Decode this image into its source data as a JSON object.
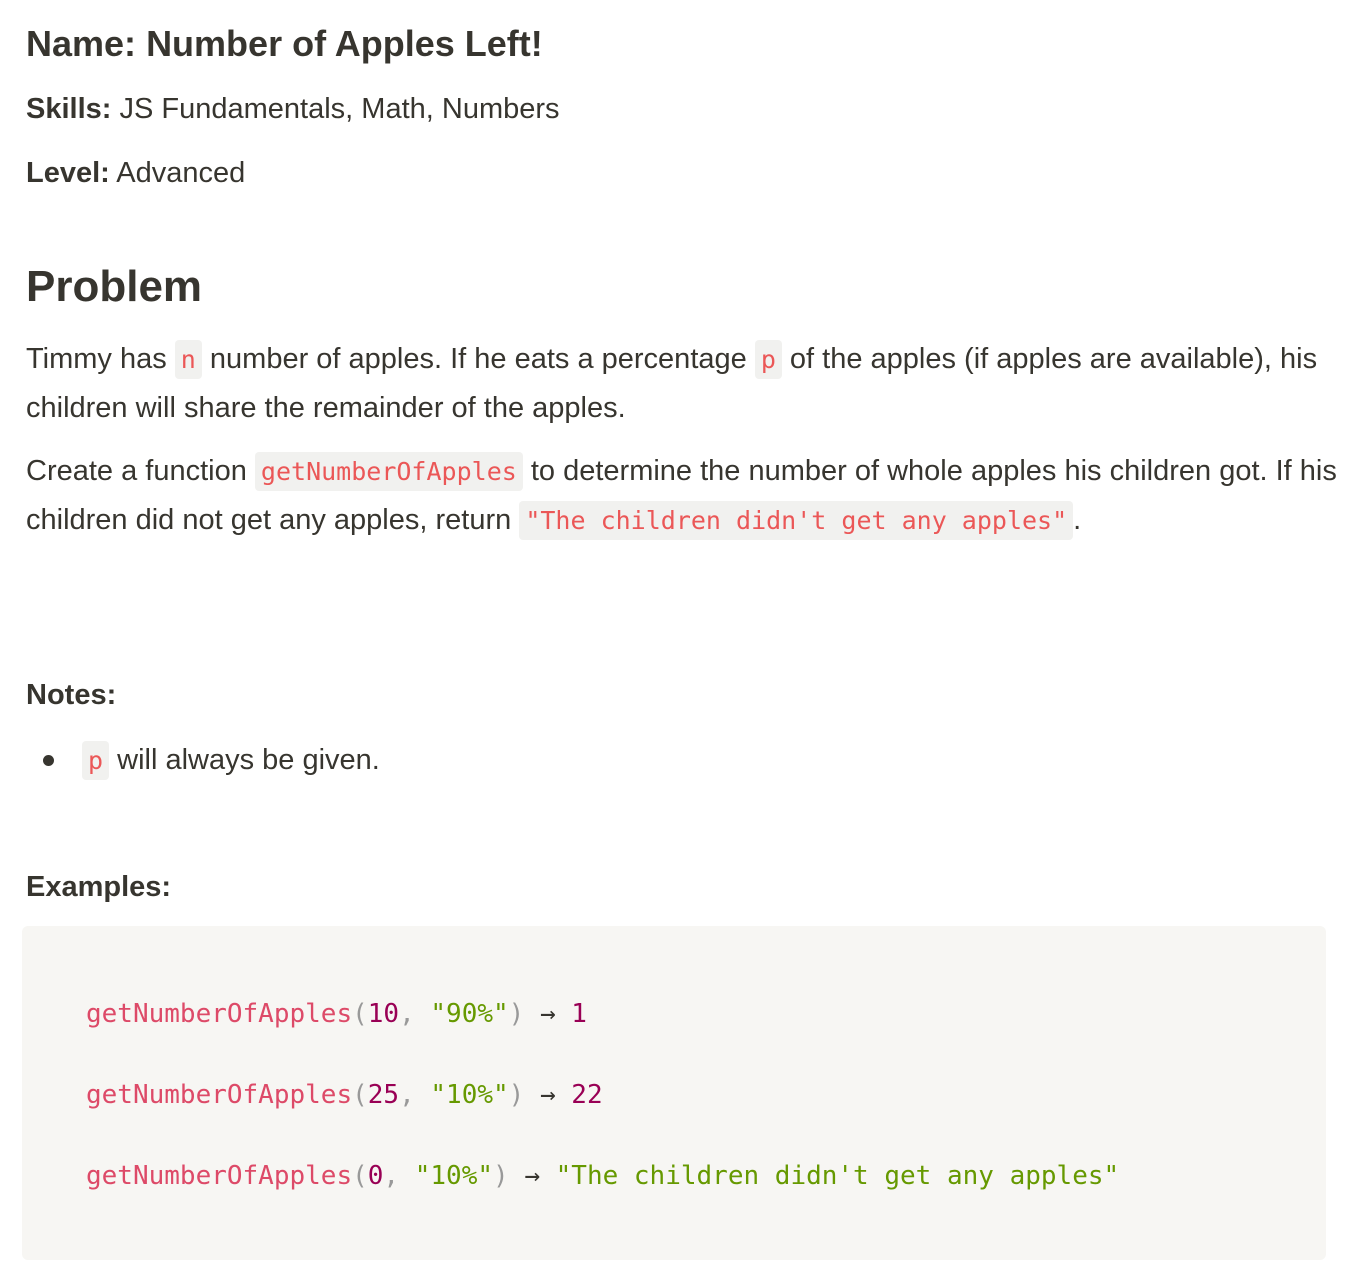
{
  "header": {
    "name_label": "Name:",
    "name_value": "Number of Apples Left!",
    "skills_label": "Skills:",
    "skills_value": "JS Fundamentals, Math, Numbers",
    "level_label": "Level:",
    "level_value": "Advanced"
  },
  "problem": {
    "heading": "Problem",
    "p1_text_1": "Timmy has ",
    "p1_code_n": "n",
    "p1_text_2": " number of apples. If he eats a percentage ",
    "p1_code_p": "p",
    "p1_text_3": " of the apples (if apples are available), his children will share the remainder of the apples.",
    "p2_text_1": "Create a function ",
    "p2_code_fn": "getNumberOfApples",
    "p2_text_2": " to determine the number of whole apples his children got. If his children did not get any apples, return ",
    "p2_code_return": "\"The children didn't get any apples\"",
    "p2_text_3": "."
  },
  "notes": {
    "heading": "Notes:",
    "items": [
      {
        "code": "p",
        "text": " will always be given."
      }
    ]
  },
  "examples": {
    "heading": "Examples:",
    "lines": [
      {
        "fn": "getNumberOfApples",
        "open": "(",
        "arg1": "10",
        "comma": ", ",
        "arg2": "\"90%\"",
        "close": ")",
        "arrow": " → ",
        "result": "1",
        "result_kind": "number"
      },
      {
        "fn": "getNumberOfApples",
        "open": "(",
        "arg1": "25",
        "comma": ", ",
        "arg2": "\"10%\"",
        "close": ")",
        "arrow": " → ",
        "result": "22",
        "result_kind": "number"
      },
      {
        "fn": "getNumberOfApples",
        "open": "(",
        "arg1": "0",
        "comma": ", ",
        "arg2": "\"10%\"",
        "close": ")",
        "arrow": " → ",
        "result": "\"The children didn't get any apples\"",
        "result_kind": "string"
      }
    ]
  },
  "colors": {
    "text": "#37352f",
    "inline_code": "#eb5757",
    "inline_code_bg": "#f1f1ef",
    "code_block_bg": "#f7f6f3",
    "code_function": "#dd4a68",
    "code_number": "#990055",
    "code_string": "#669900",
    "code_punctuation": "#999999"
  }
}
